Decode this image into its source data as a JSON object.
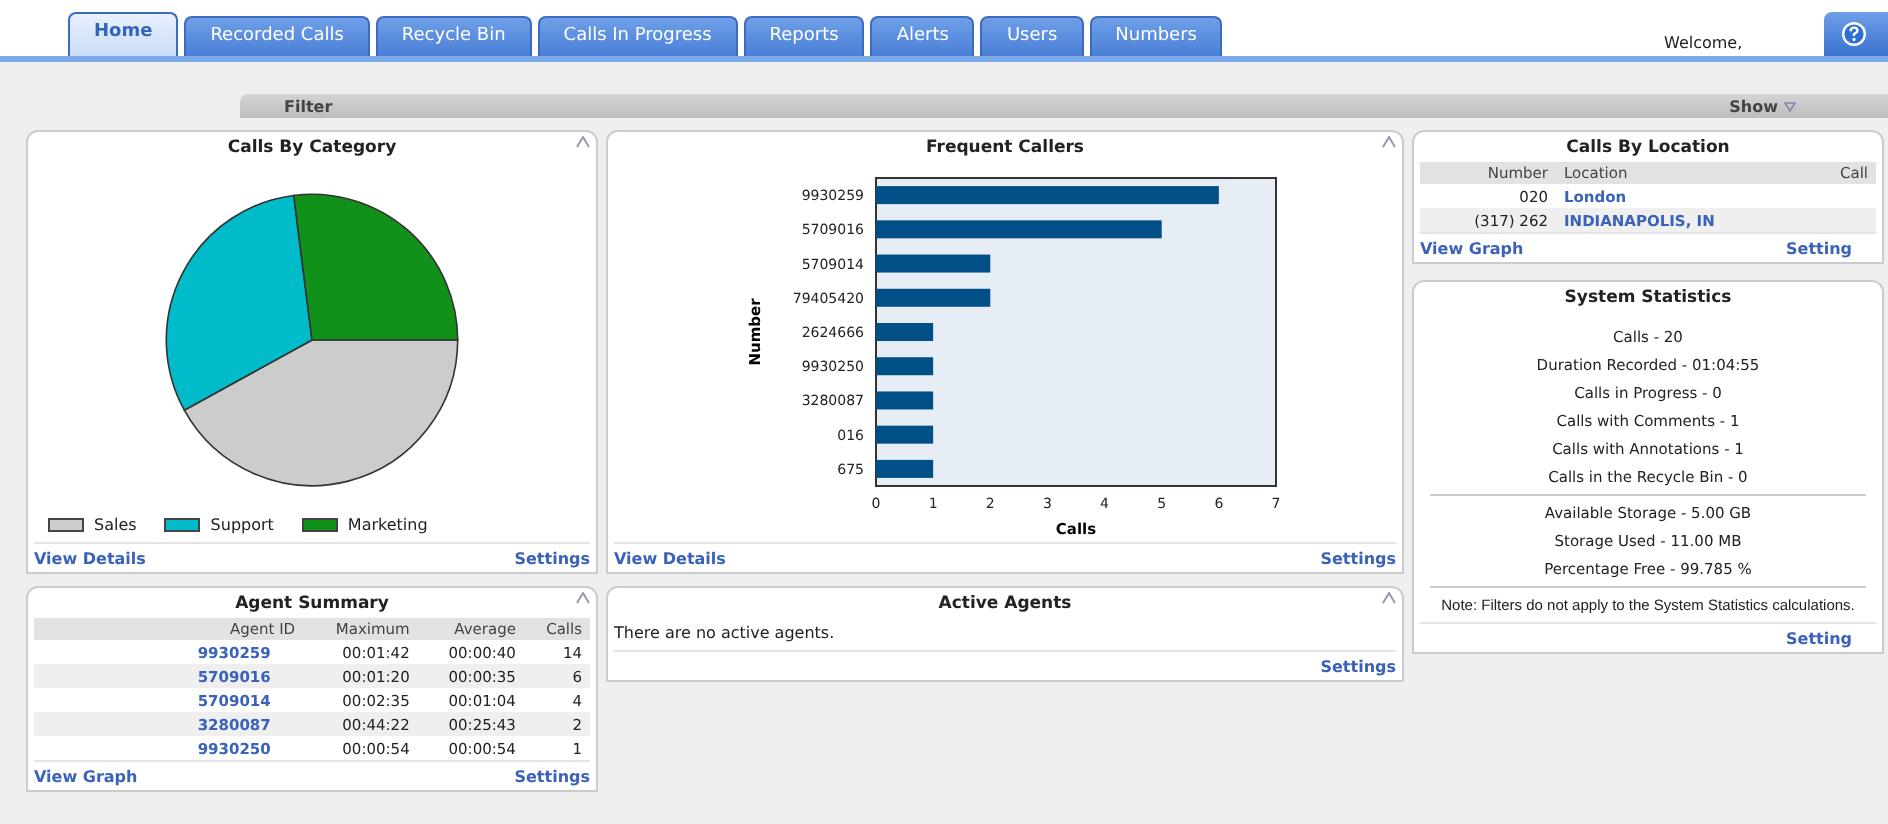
{
  "tabs": [
    {
      "label": "Home",
      "selected": true
    },
    {
      "label": "Recorded Calls",
      "selected": false
    },
    {
      "label": "Recycle Bin",
      "selected": false
    },
    {
      "label": "Calls In Progress",
      "selected": false
    },
    {
      "label": "Reports",
      "selected": false
    },
    {
      "label": "Alerts",
      "selected": false
    },
    {
      "label": "Users",
      "selected": false
    },
    {
      "label": "Numbers",
      "selected": false
    }
  ],
  "welcome": "Welcome,",
  "filter": {
    "label": "Filter",
    "toggle": "Show"
  },
  "calls_by_category": {
    "title": "Calls By Category",
    "legend": [
      {
        "label": "Sales",
        "color": "#cccccc"
      },
      {
        "label": "Support",
        "color": "#00bcca"
      },
      {
        "label": "Marketing",
        "color": "#119119"
      }
    ],
    "links": [
      "View Details",
      "Settings"
    ]
  },
  "frequent_callers": {
    "title": "Frequent Callers",
    "chart_data": {
      "type": "bar",
      "orientation": "horizontal",
      "xlabel": "Calls",
      "ylabel": "Number",
      "categories": [
        "9930259",
        "5709016",
        "5709014",
        "79405420",
        "2624666",
        "9930250",
        "3280087",
        "016",
        "675"
      ],
      "series": [
        {
          "color": "#004f86",
          "values": [
            6,
            5,
            2,
            2,
            1,
            1,
            1,
            1,
            1
          ]
        }
      ],
      "xlim": [
        0,
        7
      ],
      "xticks": [
        0,
        1,
        2,
        3,
        4,
        5,
        6,
        7
      ]
    },
    "links": [
      "View Details",
      "Settings"
    ]
  },
  "calls_by_location": {
    "title": "Calls By Location",
    "columns": [
      "Number",
      "Location",
      "Call"
    ],
    "rows": [
      {
        "number": "020",
        "location": "London"
      },
      {
        "number": "(317) 262",
        "location": "INDIANAPOLIS, IN"
      }
    ],
    "links": [
      "View Graph",
      "Setting"
    ]
  },
  "system_statistics": {
    "title": "System Statistics",
    "groups": [
      [
        "Calls - 20",
        "Duration Recorded - 01:04:55",
        "Calls in Progress - 0",
        "Calls with Comments - 1",
        "Calls with Annotations - 1",
        "Calls in the Recycle Bin - 0"
      ],
      [
        "Available Storage - 5.00 GB",
        "Storage Used - 11.00 MB",
        "Percentage Free - 99.785 %"
      ]
    ],
    "note": "Note: Filters do not apply to the System Statistics calculations.",
    "links": [
      "Setting"
    ]
  },
  "agent_summary": {
    "title": "Agent Summary",
    "columns": [
      "Agent ID",
      "Maximum",
      "Average",
      "Calls"
    ],
    "rows": [
      [
        "9930259",
        "00:01:42",
        "00:00:40",
        "14"
      ],
      [
        "5709016",
        "00:01:20",
        "00:00:35",
        "6"
      ],
      [
        "5709014",
        "00:02:35",
        "00:01:04",
        "4"
      ],
      [
        "3280087",
        "00:44:22",
        "00:25:43",
        "2"
      ],
      [
        "9930250",
        "00:00:54",
        "00:00:54",
        "1"
      ]
    ],
    "links": [
      "View Graph",
      "Settings"
    ]
  },
  "active_agents": {
    "title": "Active Agents",
    "message": "There are no active agents.",
    "links": [
      "Settings"
    ]
  }
}
